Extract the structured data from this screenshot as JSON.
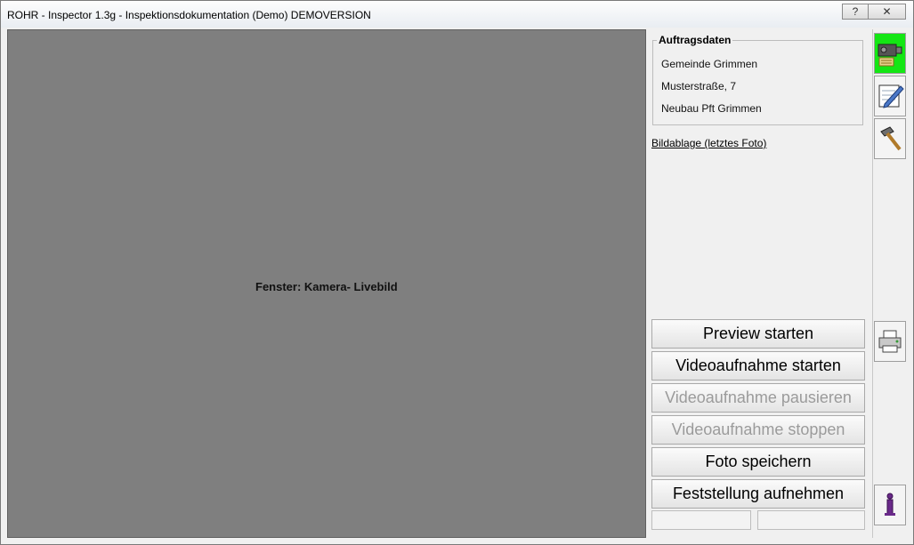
{
  "window": {
    "title": "ROHR - Inspector 1.3g - Inspektionsdokumentation (Demo) DEMOVERSION",
    "help_glyph": "?",
    "close_glyph": "✕"
  },
  "video": {
    "label": "Fenster: Kamera- Livebild"
  },
  "order_data": {
    "title": "Auftragsdaten",
    "lines": [
      "Gemeinde Grimmen",
      "Musterstraße, 7",
      "Neubau Pft Grimmen"
    ]
  },
  "photo_link": "Bildablage (letztes Foto)",
  "buttons": [
    {
      "label": "Preview starten",
      "enabled": true
    },
    {
      "label": "Videoaufnahme starten",
      "enabled": true
    },
    {
      "label": "Videoaufnahme pausieren",
      "enabled": false
    },
    {
      "label": "Videoaufnahme stoppen",
      "enabled": false
    },
    {
      "label": "Foto speichern",
      "enabled": true
    },
    {
      "label": "Feststellung aufnehmen",
      "enabled": true
    }
  ],
  "toolbar": [
    {
      "icon": "camera-icon",
      "active": true,
      "active_color": "#14e614"
    },
    {
      "icon": "notepad-edit-icon",
      "active": false
    },
    {
      "icon": "hammer-icon",
      "active": false
    },
    {
      "icon": "printer-icon",
      "active": false
    },
    {
      "icon": "info-icon",
      "active": false
    }
  ]
}
